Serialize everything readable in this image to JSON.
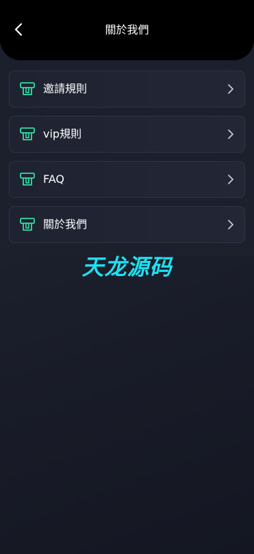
{
  "header": {
    "title": "關於我們",
    "back_icon": "chevron-left-icon"
  },
  "menu": {
    "items": [
      {
        "label": "邀請規則",
        "icon": "ticket-icon"
      },
      {
        "label": "vip規則",
        "icon": "ticket-icon"
      },
      {
        "label": "FAQ",
        "icon": "ticket-icon"
      },
      {
        "label": "關於我們",
        "icon": "ticket-icon"
      }
    ],
    "chevron_icon": "chevron-right-icon"
  },
  "watermark": {
    "text": "天龙源码"
  },
  "colors": {
    "header_bg": "#000000",
    "page_bg": "#1c1f2c",
    "card_border": "#2d3544",
    "icon_accent": "#2fe0a8",
    "watermark": "#1ee0f0"
  }
}
